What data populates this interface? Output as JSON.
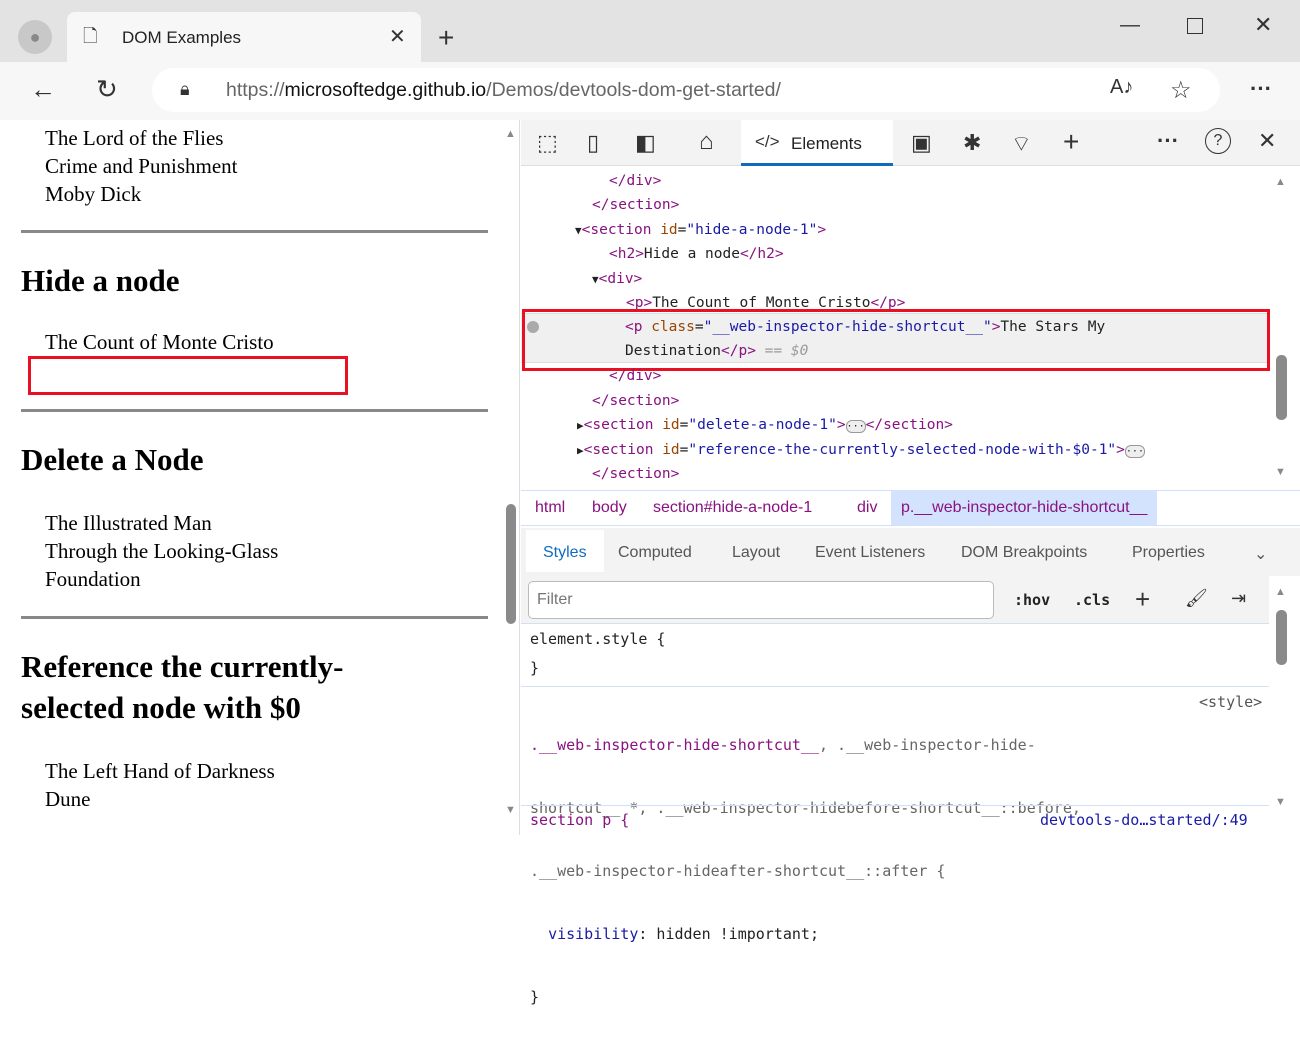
{
  "browser": {
    "tab_title": "DOM Examples",
    "url_prefix": "https://",
    "url_host": "microsoftedge.github.io",
    "url_path": "/Demos/devtools-dom-get-started/"
  },
  "page": {
    "books_top": [
      "The Lord of the Flies",
      "Crime and Punishment",
      "Moby Dick"
    ],
    "hide_heading": "Hide a node",
    "hide_books": [
      "The Count of Monte Cristo"
    ],
    "delete_heading": "Delete a Node",
    "delete_books": [
      "The Illustrated Man",
      "Through the Looking-Glass",
      "Foundation"
    ],
    "ref_heading_1": "Reference the currently-",
    "ref_heading_2": "selected node with $0",
    "ref_books": [
      "The Left Hand of Darkness",
      "Dune"
    ]
  },
  "devtools": {
    "tabs": {
      "elements": "Elements"
    },
    "dom": {
      "l1": "</div>",
      "l2": "</section>",
      "l3_tag": "<section ",
      "l3_attr": "id",
      "l3_val": "\"hide-a-node-1\"",
      "l3_end": ">",
      "l4_open": "<h2>",
      "l4_text": "Hide a node",
      "l4_close": "</h2>",
      "l5": "<div>",
      "l6_open": "<p>",
      "l6_text": "The Count of Monte Cristo",
      "l6_close": "</p>",
      "sel_tag": "<p ",
      "sel_attr": "class",
      "sel_val": "\"__web-inspector-hide-shortcut__\"",
      "sel_end": ">",
      "sel_text1": "The Stars My",
      "sel_text2": "Destination",
      "sel_close": "</p>",
      "sel_ref": " == $0",
      "l8": "</div>",
      "l9": "</section>",
      "l10_tag": "<section ",
      "l10_attr": "id",
      "l10_val": "\"delete-a-node-1\"",
      "l10_end": ">",
      "l10_close": "</section>",
      "l11_tag": "<section ",
      "l11_attr": "id",
      "l11_val": "\"reference-the-currently-selected-node-with-$0-1\"",
      "l11_end": ">",
      "l12": "</section>"
    },
    "breadcrumbs": [
      "html",
      "body",
      "section#hide-a-node-1",
      "div",
      "p.__web-inspector-hide-shortcut__"
    ],
    "subtabs": [
      "Styles",
      "Computed",
      "Layout",
      "Event Listeners",
      "DOM Breakpoints",
      "Properties"
    ],
    "filter_placeholder": "Filter",
    "hov": ":hov",
    "cls": ".cls",
    "styles": {
      "element_style": "element.style {",
      "close": "}",
      "rule_sel1": ".__web-inspector-hide-shortcut__",
      "rule_sel1b": ", .__web-inspector-hide-",
      "rule_sel2": "shortcut__ *, .__web-inspector-hidebefore-shortcut__::before,",
      "rule_sel3": ".__web-inspector-hideafter-shortcut__::after {",
      "rule_source": "<style>",
      "prop": "visibility",
      "val": " hidden !important;",
      "next_sel": "section p {",
      "next_source": "devtools-do…started/:49"
    }
  }
}
